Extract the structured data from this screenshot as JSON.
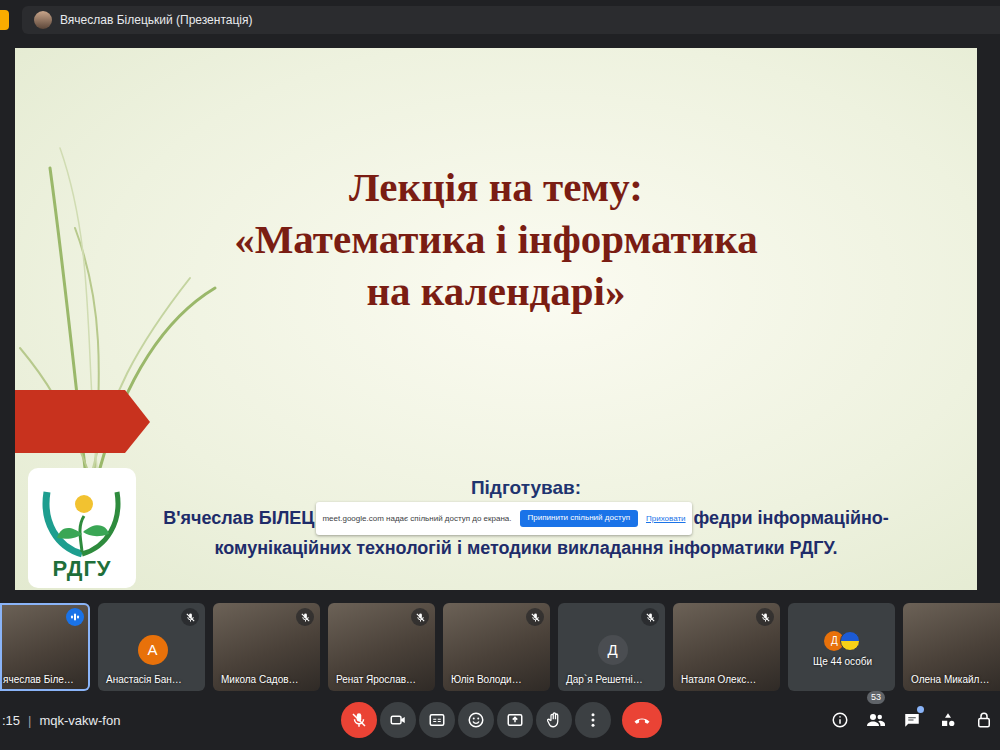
{
  "topbar": {
    "presenter": "Вячеслав Білецький (Презентація)"
  },
  "slide": {
    "title_lines": [
      "Лекція на тему:",
      "«Математика і інформатика",
      "на календарі»"
    ],
    "prepared_label": "Підготував:",
    "author_line1_left": "В'ячеслав БІЛЕЦ",
    "author_line1_right": "федри інформаційно-",
    "author_line2": "комунікаційних технологій і методики викладання інформатики РДГУ.",
    "logo_text": "РДГУ"
  },
  "share_notice": {
    "text": "meet.google.com надає спільний доступ до екрана.",
    "stop_button": "Припинити спільний доступ",
    "hide_link": "Приховати"
  },
  "participants": [
    {
      "kind": "photo",
      "name": "ячеслав Біле…",
      "muted": false,
      "speaking": true
    },
    {
      "kind": "avatar",
      "name": "Анастасія Бан…",
      "initial": "А",
      "color": "#e8710a",
      "muted": true,
      "speaking": false
    },
    {
      "kind": "photo",
      "name": "Микола Садов…",
      "muted": true,
      "speaking": false
    },
    {
      "kind": "photo",
      "name": "Ренат Ярослав…",
      "muted": true,
      "speaking": false
    },
    {
      "kind": "photo",
      "name": "Юлія Володи…",
      "muted": true,
      "speaking": false
    },
    {
      "kind": "avatar",
      "name": "Дар`я Решетні…",
      "initial": "Д",
      "color": "#4a4d51",
      "muted": true,
      "speaking": false
    },
    {
      "kind": "photo",
      "name": "Наталя Олекс…",
      "muted": true,
      "speaking": false
    },
    {
      "kind": "more",
      "name": "Ще 44 особи",
      "initial": "Д",
      "color": "#e8710a",
      "muted": false,
      "speaking": false
    },
    {
      "kind": "photo",
      "name": "Олена Микайл…",
      "muted": false,
      "speaking": false
    }
  ],
  "bottom_bar": {
    "time": ":15",
    "separator": "|",
    "meeting_code": "mqk-vakw-fon",
    "people_count": "53",
    "mic_muted": true,
    "chat_unread": true
  }
}
